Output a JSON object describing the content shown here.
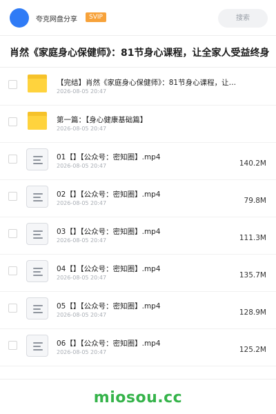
{
  "header": {
    "app_name": "夸克网盘分享",
    "badge": "SVIP",
    "search_placeholder": "搜索"
  },
  "page": {
    "title": "肖然《家庭身心保健师》：81节身心课程，让全家人受益终身"
  },
  "items": [
    {
      "kind": "folder",
      "name": "【完结】肖然《家庭身心保健师》：81节身心课程，让…",
      "date": "2026-08-05 20:47",
      "size": ""
    },
    {
      "kind": "folder",
      "name": "第一篇：【身心健康基础篇】",
      "date": "2026-08-05 20:47",
      "size": ""
    },
    {
      "kind": "file",
      "name": "01【】【公众号：密知圈】.mp4",
      "date": "2026-08-05 20:47",
      "size": "140.2M"
    },
    {
      "kind": "file",
      "name": "02【】【公众号：密知圈】.mp4",
      "date": "2026-08-05 20:47",
      "size": "79.8M"
    },
    {
      "kind": "file",
      "name": "03【】【公众号：密知圈】.mp4",
      "date": "2026-08-05 20:47",
      "size": "111.3M"
    },
    {
      "kind": "file",
      "name": "04【】【公众号：密知圈】.mp4",
      "date": "2026-08-05 20:47",
      "size": "135.7M"
    },
    {
      "kind": "file",
      "name": "05【】【公众号：密知圈】.mp4",
      "date": "2026-08-05 20:47",
      "size": "128.9M"
    },
    {
      "kind": "file",
      "name": "06【】【公众号：密知圈】.mp4",
      "date": "2026-08-05 20:47",
      "size": "125.2M"
    }
  ],
  "footer": {
    "brand": "miosou.cc"
  },
  "colors": {
    "avatar": "#2f7bf6",
    "svip_badge": "#f7a23a",
    "folder": "#ffd33d",
    "brand": "#35b34a"
  }
}
